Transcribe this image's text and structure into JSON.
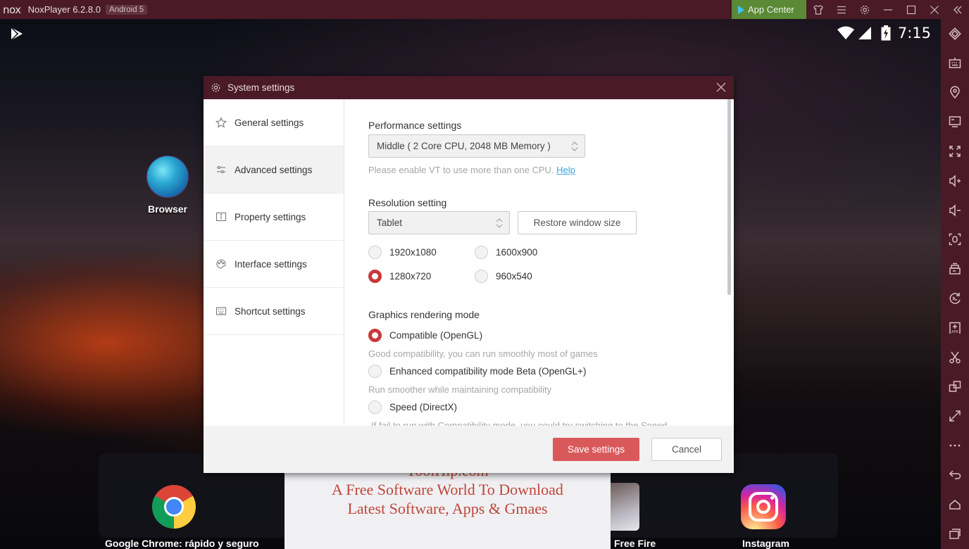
{
  "titlebar": {
    "logo": "nox",
    "app_title": "NoxPlayer 6.2.8.0",
    "android_badge": "Android 5",
    "app_center_label": "App Center",
    "icons": [
      "theme-shirt-icon",
      "menu-icon",
      "settings-gear-icon",
      "minimize-icon",
      "maximize-icon",
      "close-icon",
      "collapse-sidebar-icon"
    ]
  },
  "statusbar": {
    "time": "7:15",
    "icons": [
      "play-store-icon",
      "wifi-icon",
      "signal-icon",
      "battery-charging-icon"
    ]
  },
  "desktop": {
    "icons": [
      {
        "label": "Browser",
        "icon": "globe-icon"
      }
    ]
  },
  "dock": {
    "apps": [
      {
        "label": "Google Chrome: rápido y seguro",
        "icon": "chrome-icon"
      },
      {
        "label": "Free Fire",
        "icon": "free-fire-icon"
      },
      {
        "label": "Instagram",
        "icon": "instagram-icon"
      }
    ]
  },
  "watermark": {
    "line1": "ToolHip.com",
    "line2": "A Free Software World To Download",
    "line3": "Latest Software, Apps & Gmaes"
  },
  "sidebar": {
    "items": [
      {
        "name": "rotate-icon"
      },
      {
        "name": "keyboard-icon"
      },
      {
        "name": "location-icon"
      },
      {
        "name": "screen-icon"
      },
      {
        "name": "fullscreen-icon"
      },
      {
        "name": "volume-up-icon"
      },
      {
        "name": "volume-down-icon"
      },
      {
        "name": "screenshot-icon"
      },
      {
        "name": "toolbox-icon"
      },
      {
        "name": "macro-record-icon"
      },
      {
        "name": "apk-install-icon"
      },
      {
        "name": "scissors-icon"
      },
      {
        "name": "multi-instance-icon"
      },
      {
        "name": "resize-icon"
      },
      {
        "name": "more-icon"
      },
      {
        "name": "back-icon"
      },
      {
        "name": "home-icon"
      },
      {
        "name": "recent-apps-icon"
      }
    ]
  },
  "dialog": {
    "title": "System settings",
    "nav": [
      {
        "label": "General settings",
        "icon": "star-icon",
        "active": false
      },
      {
        "label": "Advanced settings",
        "icon": "sliders-icon",
        "active": true
      },
      {
        "label": "Property settings",
        "icon": "info-icon",
        "active": false
      },
      {
        "label": "Interface settings",
        "icon": "palette-icon",
        "active": false
      },
      {
        "label": "Shortcut settings",
        "icon": "keyboard-icon",
        "active": false
      }
    ],
    "performance": {
      "title": "Performance settings",
      "selected": "Middle ( 2 Core CPU, 2048 MB Memory )",
      "hint": "Please enable VT to use more than one CPU.",
      "help_link": "Help"
    },
    "resolution": {
      "title": "Resolution setting",
      "selected": "Tablet",
      "restore_label": "Restore window size",
      "options": [
        {
          "label": "1920x1080",
          "checked": false
        },
        {
          "label": "1600x900",
          "checked": false
        },
        {
          "label": "1280x720",
          "checked": true
        },
        {
          "label": "960x540",
          "checked": false
        }
      ]
    },
    "graphics": {
      "title": "Graphics rendering mode",
      "options": [
        {
          "label": "Compatible (OpenGL)",
          "checked": true,
          "desc": "Good compatibility, you can run smoothly most of games"
        },
        {
          "label": "Enhanced compatibility mode Beta (OpenGL+)",
          "checked": false,
          "desc": "Run smoother while maintaining compatibility"
        },
        {
          "label": "Speed (DirectX)",
          "checked": false,
          "desc": "If fail to run with Compatibility mode, you could try switching to the Speed"
        }
      ]
    },
    "footer": {
      "save_label": "Save settings",
      "cancel_label": "Cancel"
    }
  },
  "colors": {
    "titlebar_bg": "#4a1a27",
    "app_center_bg": "#5a8a35",
    "accent_red": "#c9383b",
    "save_button": "#d9595b",
    "link": "#3aa4e0",
    "watermark_text": "#c0463a"
  }
}
